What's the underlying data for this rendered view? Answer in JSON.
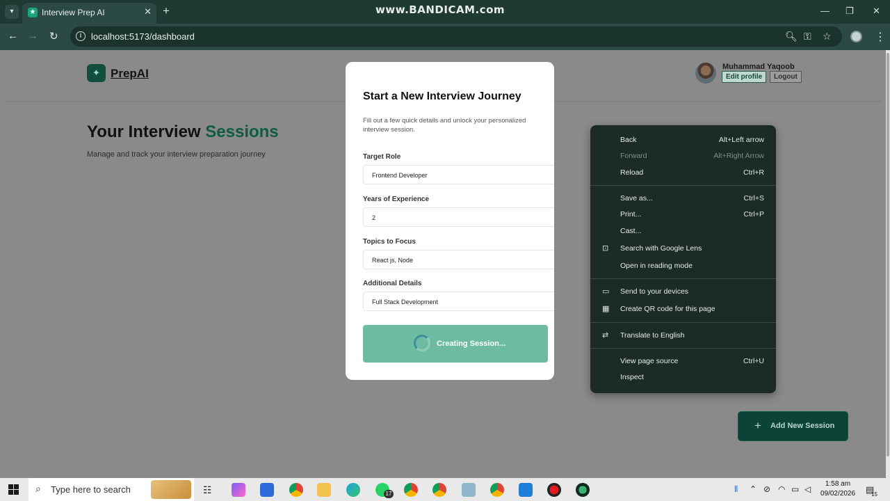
{
  "browser": {
    "tab_title": "Interview Prep AI",
    "tab_favicon": "★",
    "watermark": "www.BANDICAM.com",
    "url": "localhost:5173/dashboard",
    "icons": [
      "tab-search-icon",
      "close-icon",
      "new-tab-icon",
      "minimize-icon",
      "maximize-icon",
      "back-icon",
      "forward-icon",
      "reload-icon",
      "site-info-icon",
      "zoom-icon",
      "password-key-icon",
      "bookmark-star-icon",
      "profile-icon",
      "more-menu-icon"
    ]
  },
  "app": {
    "logo_text": "PrepAI",
    "user_name": "Muhammad Yaqoob",
    "edit_profile": "Edit profile",
    "logout": "Logout",
    "title_part1": "Your Interview ",
    "title_part2": "Sessions",
    "subtitle": "Manage and track your interview preparation journey",
    "add_button": "Add New Session",
    "accent_color": "#0f5c44"
  },
  "modal": {
    "title": "Start a New Interview Journey",
    "description": "Fill out a few quick details and unlock your personalized interview session.",
    "fields": [
      {
        "label": "Target Role",
        "value": "Frontend Developer"
      },
      {
        "label": "Years of Experience",
        "value": "2"
      },
      {
        "label": "Topics to Focus",
        "value": "React js, Node"
      },
      {
        "label": "Additional Details",
        "value": "Full Stack Development"
      }
    ],
    "submit_label": "Creating Session..."
  },
  "context_menu": {
    "groups": [
      [
        {
          "label": "Back",
          "shortcut": "Alt+Left arrow",
          "disabled": false
        },
        {
          "label": "Forward",
          "shortcut": "Alt+Right Arrow",
          "disabled": true
        },
        {
          "label": "Reload",
          "shortcut": "Ctrl+R",
          "disabled": false
        }
      ],
      [
        {
          "label": "Save as...",
          "shortcut": "Ctrl+S"
        },
        {
          "label": "Print...",
          "shortcut": "Ctrl+P"
        },
        {
          "label": "Cast...",
          "shortcut": ""
        },
        {
          "label": "Search with Google Lens",
          "shortcut": "",
          "icon": "google-lens-icon"
        },
        {
          "label": "Open in reading mode",
          "shortcut": ""
        }
      ],
      [
        {
          "label": "Send to your devices",
          "shortcut": "",
          "icon": "devices-icon"
        },
        {
          "label": "Create QR code for this page",
          "shortcut": "",
          "icon": "qr-code-icon"
        }
      ],
      [
        {
          "label": "Translate to English",
          "shortcut": "",
          "icon": "translate-icon"
        }
      ],
      [
        {
          "label": "View page source",
          "shortcut": "Ctrl+U"
        },
        {
          "label": "Inspect",
          "shortcut": ""
        }
      ]
    ]
  },
  "taskbar": {
    "search_placeholder": "Type here to search",
    "whatsapp_badge": "17",
    "time": "1:58 am",
    "date": "09/02/2026",
    "notification_count": "15"
  }
}
